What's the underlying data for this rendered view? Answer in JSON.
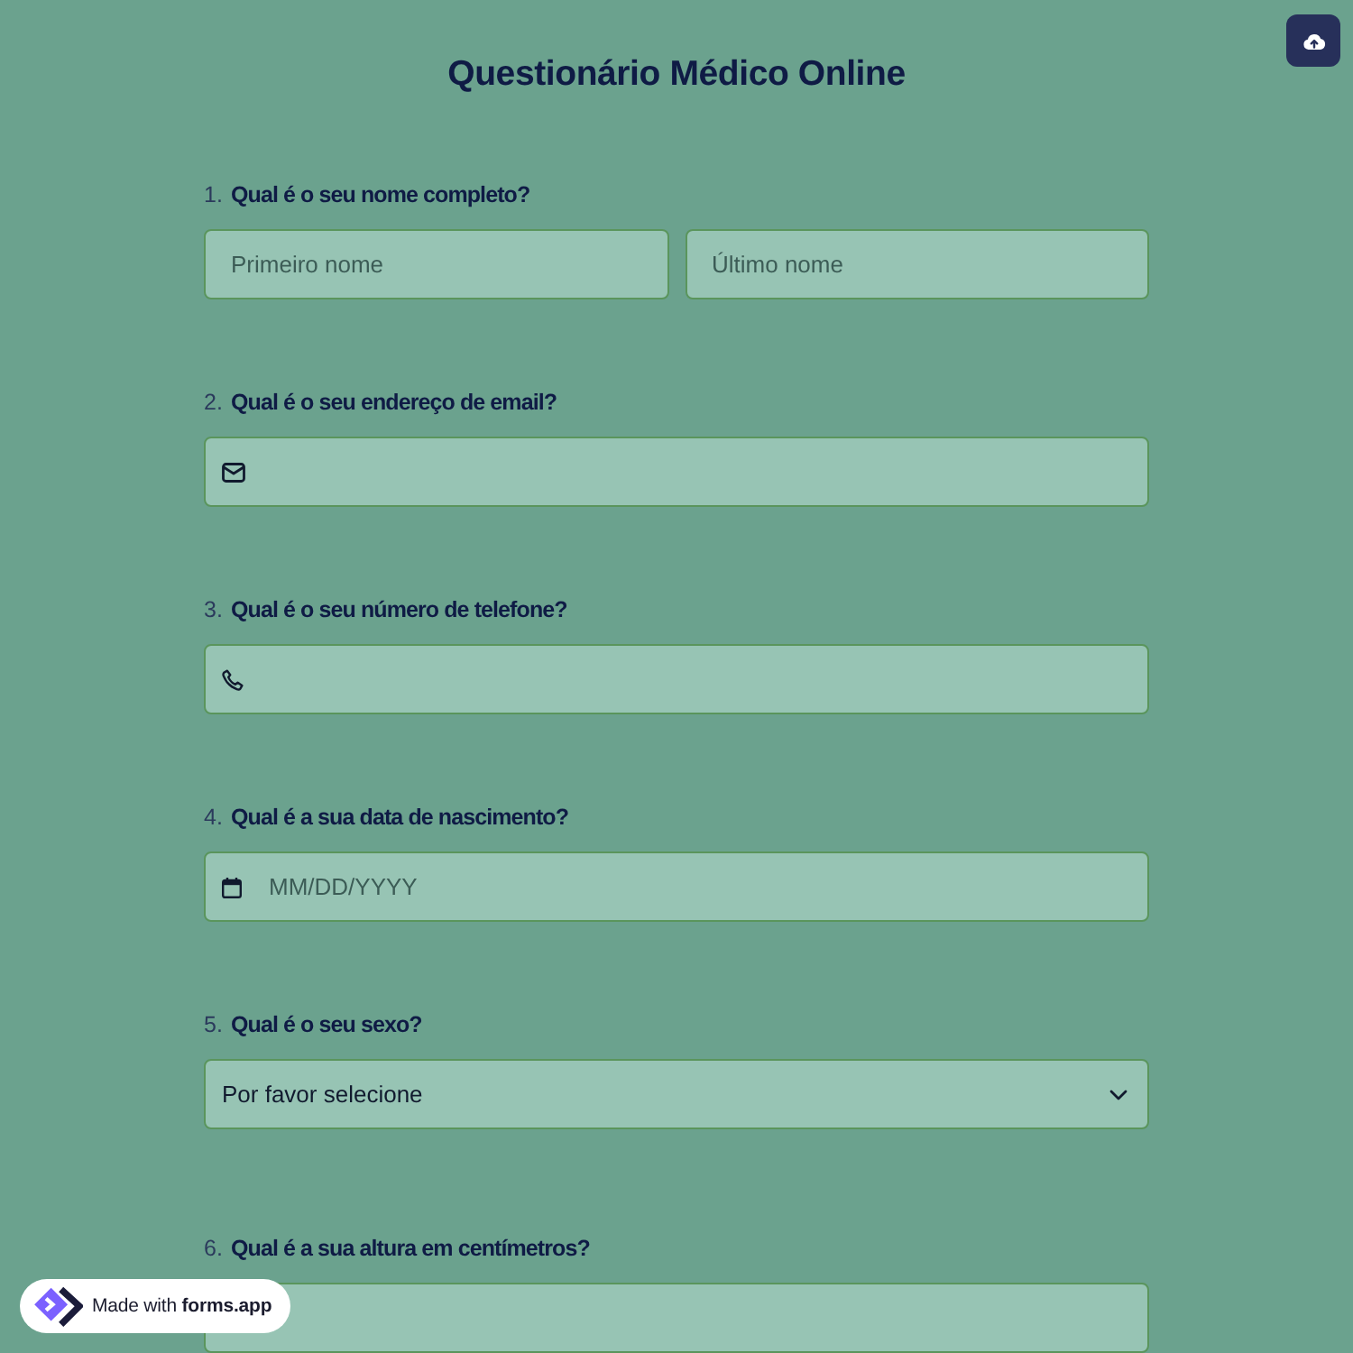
{
  "title": "Questionário Médico Online",
  "questions": [
    {
      "number": "1.",
      "label": "Qual é o seu nome completo?",
      "kind": "name",
      "fields": [
        {
          "placeholder": "Primeiro nome"
        },
        {
          "placeholder": "Último nome"
        }
      ]
    },
    {
      "number": "2.",
      "label": "Qual é o seu endereço de email?",
      "kind": "email"
    },
    {
      "number": "3.",
      "label": "Qual é o seu número de telefone?",
      "kind": "phone"
    },
    {
      "number": "4.",
      "label": "Qual é a sua data de nascimento?",
      "kind": "date",
      "placeholder": "MM/DD/YYYY"
    },
    {
      "number": "5.",
      "label": "Qual é o seu sexo?",
      "kind": "select",
      "value": "Por favor selecione"
    },
    {
      "number": "6.",
      "label": "Qual é a sua altura em centímetros?",
      "kind": "number"
    }
  ],
  "badge": {
    "text": "Made with **forms.app**"
  }
}
